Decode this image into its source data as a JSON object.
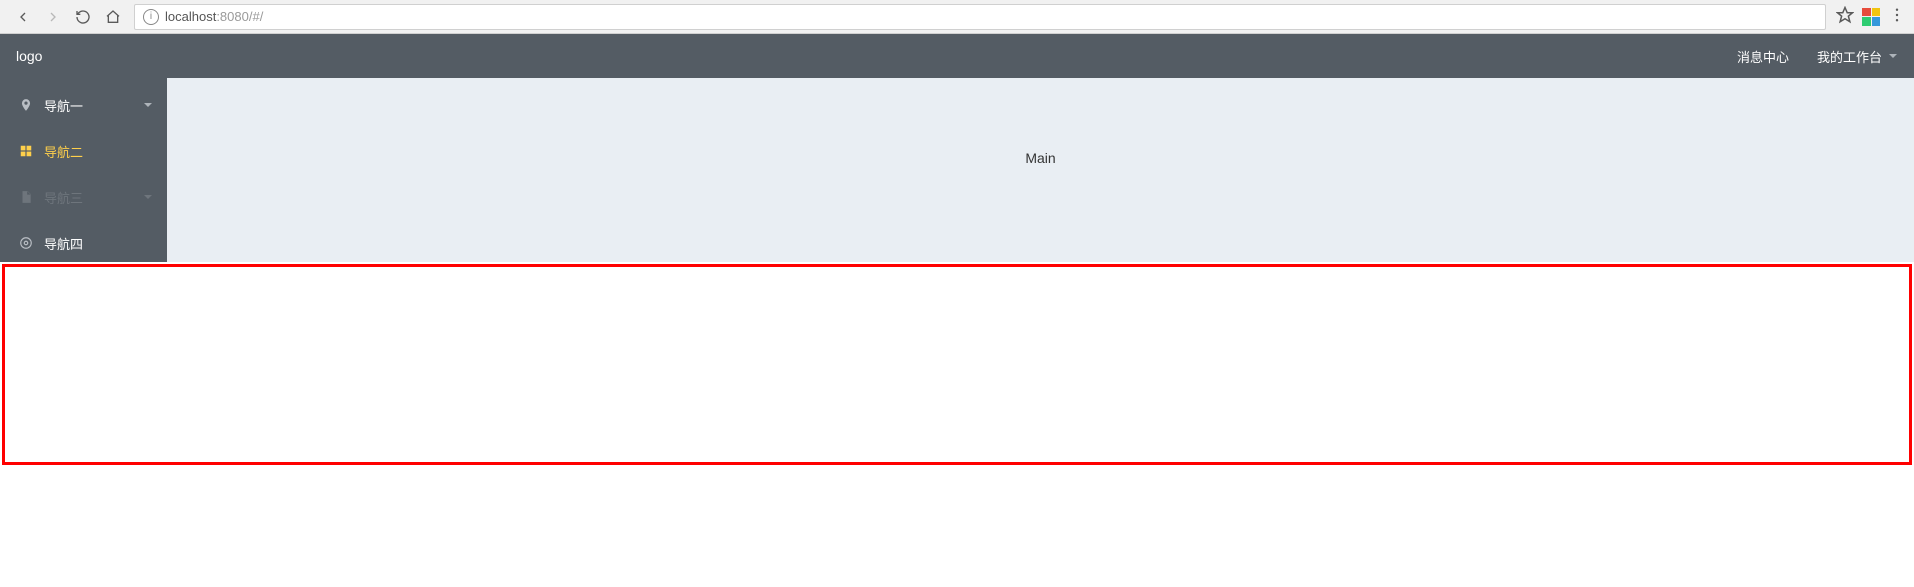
{
  "browser": {
    "url_host": "localhost",
    "url_port": ":8080",
    "url_path": "/#/"
  },
  "header": {
    "logo": "logo",
    "links": {
      "messages": "消息中心",
      "workspace": "我的工作台"
    }
  },
  "sidebar": {
    "items": [
      {
        "label": "导航一"
      },
      {
        "label": "导航二"
      },
      {
        "label": "导航三"
      },
      {
        "label": "导航四"
      }
    ]
  },
  "main": {
    "content": "Main"
  }
}
